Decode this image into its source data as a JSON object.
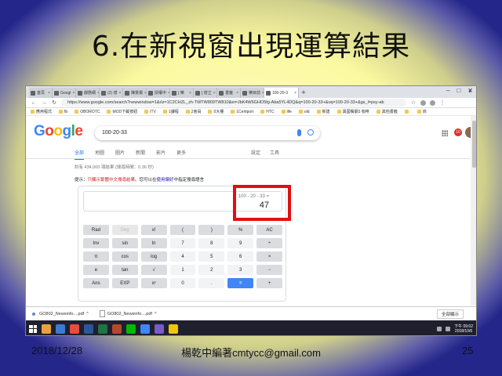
{
  "slide": {
    "title": "6.在新視窗出現運算結果",
    "date": "2018/12/28",
    "author": "楊乾中編著cmtycc@gmail.com",
    "page": "25"
  },
  "browser": {
    "tabs": [
      {
        "label": "首頁",
        "active": false
      },
      {
        "label": "Googl",
        "active": false
      },
      {
        "label": "靜態網",
        "active": false
      },
      {
        "label": "(2) 增",
        "active": false
      },
      {
        "label": "陳景揚",
        "active": false
      },
      {
        "label": "授權中",
        "active": false
      },
      {
        "label": "[ 樂",
        "active": false
      },
      {
        "label": "[ 增立",
        "active": false
      },
      {
        "label": "書籤",
        "active": false
      },
      {
        "label": "樂目前",
        "active": false
      },
      {
        "label": "100-20-3",
        "active": true
      }
    ],
    "url": "https://www.google.com/search?newwindow=1&rlz=1C2CHZL_zh-TWTW809TW810&ei=JbK4W6GHO5fg-Aba5YL4DQ&q=100-20-33+&oq=100-20-33+&gs_l=psy-ab",
    "bookmarks": [
      "應用程式",
      "fb",
      "OBOROTC",
      "MOD下載按鈕",
      "ITV",
      "1課程",
      "2會員",
      "0大樓",
      "1Certiport",
      "HTC",
      "life",
      "old",
      "新建",
      "異國餐廳3 咖啡",
      "其他書籤",
      "",
      "商"
    ]
  },
  "google": {
    "logo": {
      "G": "G",
      "o1": "o",
      "o2": "o",
      "g": "g",
      "l": "l",
      "e": "e"
    },
    "query": "100-20-33",
    "tabs": [
      "全部",
      "地圖",
      "圖片",
      "新聞",
      "影片",
      "更多"
    ],
    "tools": [
      "設定",
      "工具"
    ],
    "result_stats": "約有 434,000 項結果 (搜尋時間：0.36 秒)",
    "hint_prefix": "提示：",
    "hint_link1": "只顯示繁體中文搜尋結果",
    "hint_mid": "。您可以在",
    "hint_link2": "使用偏好",
    "hint_suffix": "中指定搜尋語言",
    "notif_count": "10"
  },
  "calculator": {
    "expression": "100 - 20 - 33 =",
    "result": "47",
    "keys": [
      [
        "Rad",
        "Deg",
        "x!",
        "(",
        ")",
        "%",
        "AC"
      ],
      [
        "Inv",
        "sin",
        "ln",
        "7",
        "8",
        "9",
        "÷"
      ],
      [
        "π",
        "cos",
        "log",
        "4",
        "5",
        "6",
        "×"
      ],
      [
        "e",
        "tan",
        "√",
        "1",
        "2",
        "3",
        "−"
      ],
      [
        "Ans",
        "EXP",
        "xʸ",
        "0",
        ".",
        "=",
        "+"
      ]
    ]
  },
  "downloads": {
    "items": [
      "GO802_Newsinfo....pdf",
      "GO802_Newsinfo....pdf"
    ],
    "show_all": "全部顯示",
    "close": "×"
  },
  "taskbar": {
    "time": "下午 09:02",
    "date": "2018/10/6"
  },
  "colors": {
    "accent": "#1a73e8",
    "highlight": "#e01010",
    "equals_key": "#4285f4"
  }
}
